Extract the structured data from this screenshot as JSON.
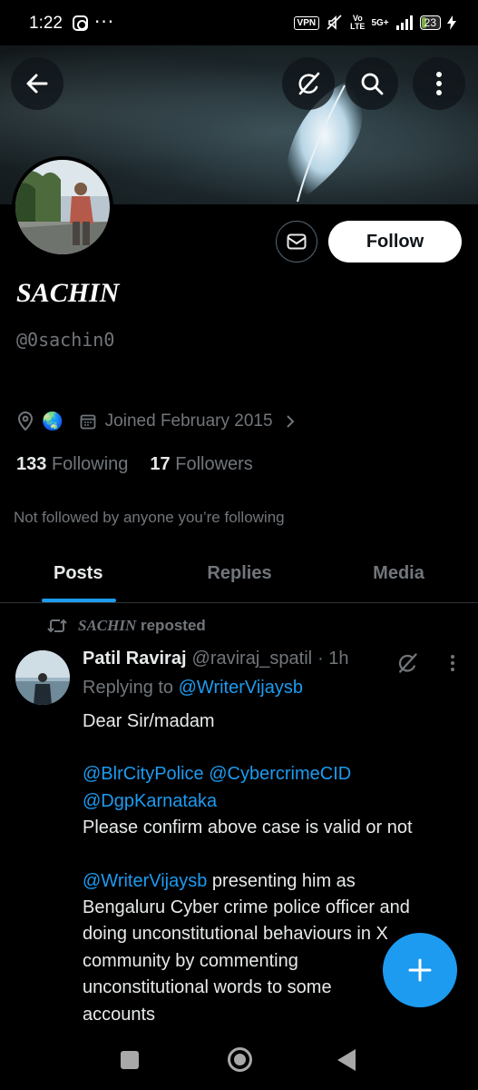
{
  "status_bar": {
    "time": "1:22",
    "more": "···",
    "vpn": "VPN",
    "volte": "Vo\nLTE",
    "network": "5G+",
    "battery": "23"
  },
  "header": {
    "back_icon": "arrow-left-icon",
    "grok_icon": "grok-icon",
    "search_icon": "search-icon",
    "more_icon": "vertical-dots-icon"
  },
  "profile": {
    "name": "SACHIN",
    "handle": "@0sachin0",
    "location_emoji": "🌏",
    "joined": "Joined February 2015",
    "following_count": "133",
    "following_label": "Following",
    "followers_count": "17",
    "followers_label": "Followers",
    "not_followed": "Not followed by anyone you’re following",
    "follow_label": "Follow"
  },
  "tabs": [
    {
      "label": "Posts"
    },
    {
      "label": "Replies"
    },
    {
      "label": "Media"
    }
  ],
  "post": {
    "repost_name": "SACHIN",
    "repost_label": "reposted",
    "author_name": "Patil Raviraj",
    "author_handle": "@raviraj_spatil",
    "time": "· 1h",
    "replying_prefix": "Replying to",
    "replying_to": "@WriterVijaysb",
    "line1": "Dear Sir/madam",
    "mention1": "@BlrCityPolice",
    "mention2": "@CybercrimeCID",
    "mention3": "@DgpKarnataka",
    "line2": "Please confirm above case is valid or not",
    "mention4": "@WriterVijaysb",
    "line3_rest": " presenting him as",
    "line4": "Bengaluru Cyber crime police officer and",
    "line5": "doing unconstitutional behaviours in X",
    "line6": "community by commenting",
    "line7": "unconstitutional words to some",
    "line8": "accounts"
  },
  "colors": {
    "accent": "#1d9bf0",
    "muted": "#71767b",
    "text": "#e7e9ea",
    "background": "#000000"
  }
}
